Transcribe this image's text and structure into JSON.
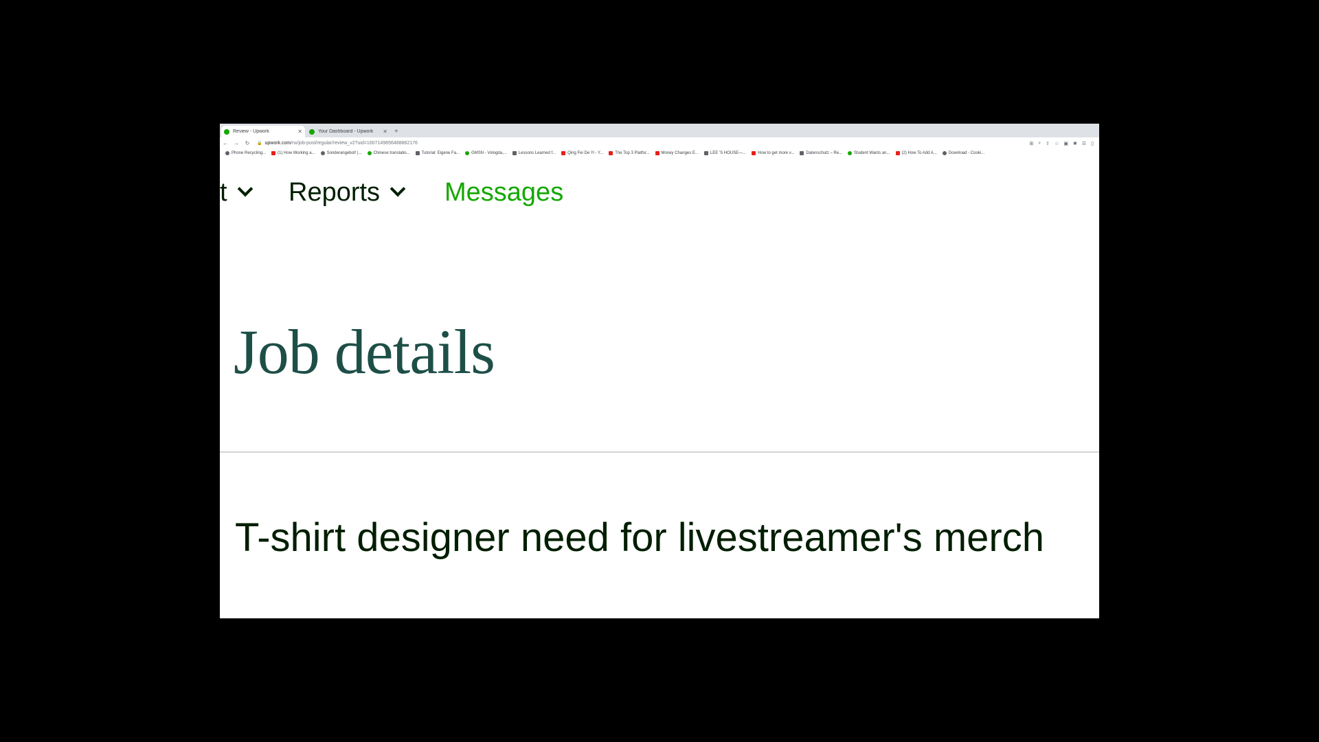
{
  "browser": {
    "tabs": [
      {
        "title": "Review - Upwork",
        "active": true
      },
      {
        "title": "Your Dashboard - Upwork",
        "active": false
      }
    ],
    "url_domain": "upwork.com",
    "url_path": "/nx/job-post/regular/review_v2?uid=1607149856488882176",
    "bookmarks": [
      "Phone Recycling...",
      "(1) How Working a...",
      "Sonderangebot! |...",
      "Chinese translatio...",
      "Tutorial: Eigene Fa...",
      "GMSN - Vologda,...",
      "Lessons Learned f...",
      "Qing Fei De Yi - Y...",
      "The Top 3 Platfor...",
      "Money Changes E...",
      "LEE 'S HOUSE—...",
      "How to get more v...",
      "Datenschutz – Re...",
      "Student Wants an...",
      "(2) How To Add A...",
      "Download - Cooki..."
    ]
  },
  "nav": {
    "partial_item": "t",
    "reports": "Reports",
    "messages": "Messages"
  },
  "page": {
    "heading": "Job details",
    "job_title": "T-shirt designer need for livestreamer's merch"
  },
  "colors": {
    "brand_green": "#14a800",
    "heading_teal": "#1d4f47",
    "text_dark": "#001e00"
  }
}
